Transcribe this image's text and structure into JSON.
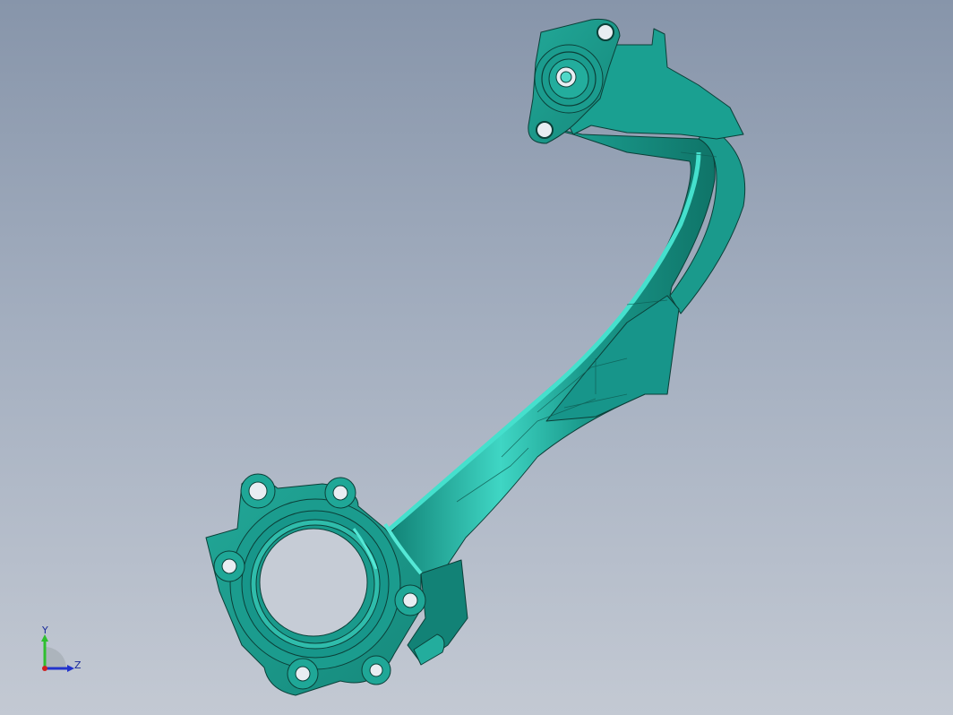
{
  "viewport": {
    "background_top": "#8795aa",
    "background_bottom": "#c3c9d3"
  },
  "model": {
    "part": "curved-bracket-casting",
    "body_color": "#1a9a8c",
    "highlight_color": "#3fd6c4",
    "edge_color": "#0b3f38"
  },
  "triad": {
    "y_label": "Y",
    "z_label": "Z",
    "y_axis_color": "#2fbf2f",
    "z_axis_color": "#2233cc",
    "origin_color": "#d02020"
  }
}
